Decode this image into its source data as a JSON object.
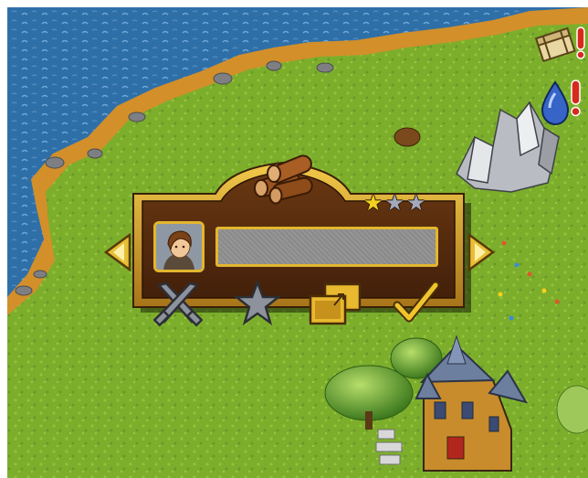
{
  "game": {
    "scene": "island-map",
    "hud": {
      "top_right_icons": [
        "treasure-chest-alert-icon",
        "water-drop-alert-icon"
      ]
    },
    "naming_panel": {
      "resource_icon": "wood-logs-icon",
      "rating": {
        "filled": 1,
        "total": 3
      },
      "portrait_icon": "settler-portrait-icon",
      "name_input_value": "",
      "name_input_placeholder": "",
      "nav": [
        "arrow-left-icon",
        "arrow-right-icon"
      ],
      "actions": [
        "crossed-swords-disabled-icon",
        "star-disabled-icon",
        "resize-windows-icon",
        "checkmark-icon"
      ]
    }
  },
  "colors": {
    "sea": "#2f6fa8",
    "grass": "#78ad2a",
    "shore": "#d8962c",
    "panel_wood": "#5a2e0e",
    "panel_gold": "#d9a62b",
    "star_gold": "#f5d21f",
    "star_grey": "#9ea3b4",
    "field_grey": "#8e8e8e"
  }
}
